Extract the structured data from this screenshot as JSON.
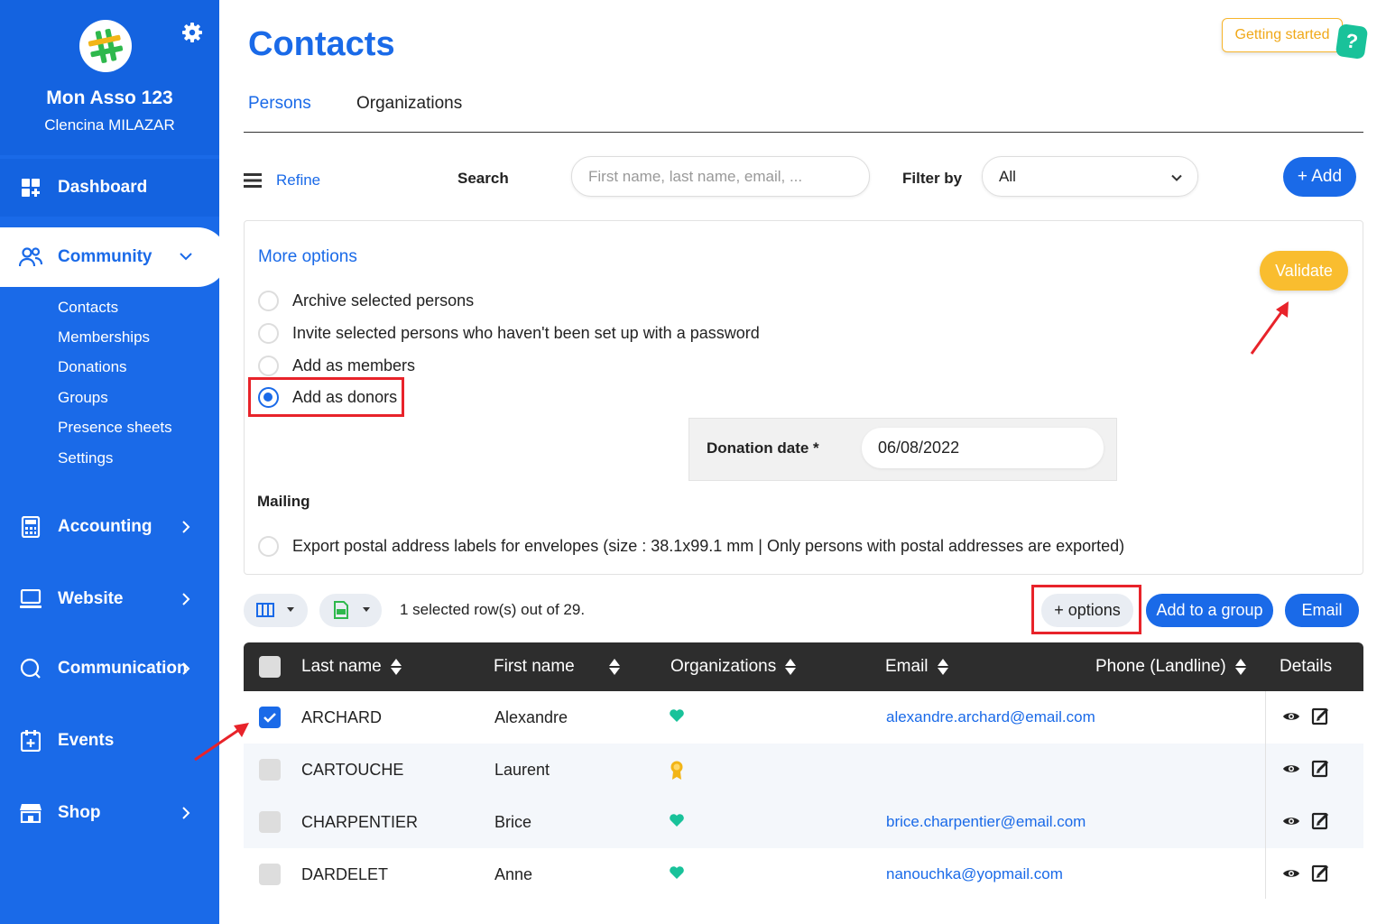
{
  "sidebar": {
    "org_name": "Mon Asso 123",
    "user_name": "Clencina MILAZAR",
    "dashboard": "Dashboard",
    "community": "Community",
    "community_items": [
      "Contacts",
      "Memberships",
      "Donations",
      "Groups",
      "Presence sheets",
      "Settings"
    ],
    "accounting": "Accounting",
    "website": "Website",
    "communication": "Communication",
    "events": "Events",
    "shop": "Shop"
  },
  "header": {
    "title": "Contacts",
    "getting_started": "Getting started",
    "help": "?"
  },
  "tabs": {
    "persons": "Persons",
    "organizations": "Organizations",
    "active": "Persons"
  },
  "filters": {
    "refine": "Refine",
    "search_label": "Search",
    "search_placeholder": "First name, last name, email, ...",
    "filter_label": "Filter by",
    "filter_value": "All",
    "add_button": "+ Add"
  },
  "options": {
    "title": "More options",
    "validate": "Validate",
    "radios": [
      {
        "label": "Archive selected persons",
        "selected": false
      },
      {
        "label": "Invite selected persons who haven't been set up with a password",
        "selected": false
      },
      {
        "label": "Add as members",
        "selected": false
      },
      {
        "label": "Add as donors",
        "selected": true
      }
    ],
    "donation_date_label": "Donation date *",
    "donation_date_value": "06/08/2022",
    "mailing_label": "Mailing",
    "mailing_option": "Export postal address labels for envelopes (size : 38.1x99.1 mm | Only persons with postal addresses are exported)"
  },
  "toolbar": {
    "selected_count": "1 selected row(s) out of 29.",
    "options_button": "+ options",
    "add_to_group": "Add to a group",
    "email": "Email"
  },
  "table": {
    "headers": {
      "last_name": "Last name",
      "first_name": "First name",
      "organizations": "Organizations",
      "email": "Email",
      "phone": "Phone (Landline)",
      "details": "Details"
    },
    "rows": [
      {
        "last_name": "ARCHARD",
        "first_name": "Alexandre",
        "org_icon": "heart-icon",
        "email": "alexandre.archard@email.com",
        "checked": true
      },
      {
        "last_name": "CARTOUCHE",
        "first_name": "Laurent",
        "org_icon": "award-icon",
        "email": "",
        "checked": false
      },
      {
        "last_name": "CHARPENTIER",
        "first_name": "Brice",
        "org_icon": "heart-icon",
        "email": "brice.charpentier@email.com",
        "checked": false
      },
      {
        "last_name": "DARDELET",
        "first_name": "Anne",
        "org_icon": "heart-icon",
        "email": "nanouchka@yopmail.com",
        "checked": false
      }
    ]
  },
  "colors": {
    "primary": "#1a6ae8",
    "accent_yellow": "#f9bd2f",
    "highlight_red": "#e8232a",
    "heart_teal": "#19c29a",
    "award_gold": "#f2b517"
  }
}
